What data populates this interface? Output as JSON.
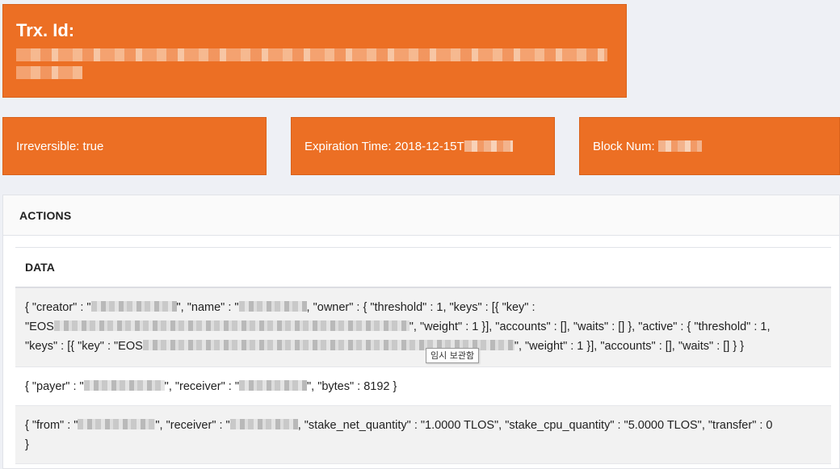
{
  "trx": {
    "title": "Trx. Id:"
  },
  "stats": {
    "irreversible": "Irreversible: true",
    "expiration_prefix": "Expiration Time: 2018-12-15T",
    "block_num_prefix": "Block Num:"
  },
  "actions": {
    "header": "ACTIONS",
    "data_header": "DATA",
    "rows": {
      "row1": {
        "p1": "{ \"creator\" : \"",
        "p2": "\", \"name\" : \"",
        "p3": ", \"owner\" : { \"threshold\" : 1, \"keys\" : [{ \"key\" :",
        "p4": "\"EOS",
        "p5": "\", \"weight\" : 1 }], \"accounts\" : [], \"waits\" : [] }, \"active\" : { \"threshold\" : 1,",
        "p6": "\"keys\" : [{ \"key\" : \"EOS",
        "p7": "\", \"weight\" : 1 }], \"accounts\" : [], \"waits\" : [] } }"
      },
      "row2": {
        "p1": "{ \"payer\" : \"",
        "p2": "\", \"receiver\" : \"",
        "p3": "\", \"bytes\" : 8192 }"
      },
      "row3": {
        "p1": "{ \"from\" : \"",
        "p2": "\", \"receiver\" : \"",
        "p3": ", \"stake_net_quantity\" : \"1.0000 TLOS\", \"stake_cpu_quantity\" : \"5.0000 TLOS\", \"transfer\" : 0",
        "p4": "}"
      }
    }
  },
  "tooltip": "임시 보관함"
}
